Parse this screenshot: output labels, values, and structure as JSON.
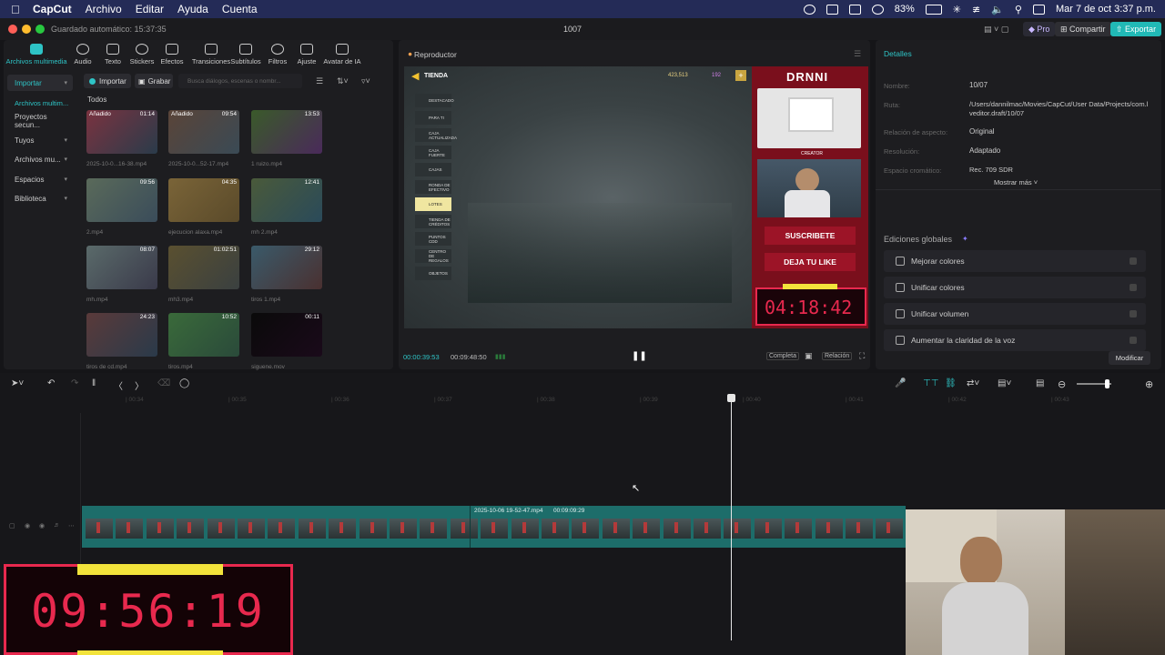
{
  "menubar": {
    "app": "CapCut",
    "items": [
      "Archivo",
      "Editar",
      "Ayuda",
      "Cuenta"
    ],
    "battery": "83%",
    "datetime": "Mar 7 de oct 3:37 p.m."
  },
  "titlebar": {
    "autosave": "Guardado automático: 15:37:35",
    "project": "1007",
    "pro": "Pro",
    "share": "Compartir",
    "export": "Exportar"
  },
  "toolbar": {
    "media": "Archivos multimedia",
    "audio": "Audio",
    "text": "Texto",
    "stickers": "Stickers",
    "effects": "Efectos",
    "transitions": "Transiciones",
    "subtitles": "Subtítulos",
    "filters": "Filtros",
    "adjust": "Ajuste",
    "ai_avatar": "Avatar de IA"
  },
  "media_panel": {
    "sidebar": {
      "import": "Importar",
      "media_files": "Archivos multim...",
      "secure_projects": "Proyectos secun...",
      "yours": "Tuyos",
      "media_more": "Archivos mu...",
      "spaces": "Espacios",
      "library": "Biblioteca"
    },
    "import_button": "Importar",
    "record_button": "Grabar",
    "search_placeholder": "Busca diálogos, escenas o nombr...",
    "filter_all": "Todos",
    "thumbs": [
      {
        "tag": "Añadido",
        "duration": "01:14",
        "name": "2025-10-0...16-38.mp4"
      },
      {
        "tag": "Añadido",
        "duration": "09:54",
        "name": "2025-10-0...52-17.mp4"
      },
      {
        "tag": "",
        "duration": "13:53",
        "name": "1 ruizo.mp4"
      },
      {
        "tag": "",
        "duration": "09:56",
        "name": "2.mp4"
      },
      {
        "tag": "",
        "duration": "04:35",
        "name": "ejecucion alaxa.mp4"
      },
      {
        "tag": "",
        "duration": "12:41",
        "name": "mh 2.mp4"
      },
      {
        "tag": "",
        "duration": "08:07",
        "name": "mh.mp4"
      },
      {
        "tag": "",
        "duration": "01:02:51",
        "name": "mh3.mp4"
      },
      {
        "tag": "",
        "duration": "29:12",
        "name": "tiros 1.mp4"
      },
      {
        "tag": "",
        "duration": "24:23",
        "name": "tiros de cd.mp4"
      },
      {
        "tag": "",
        "duration": "10:52",
        "name": "tiros.mp4"
      },
      {
        "tag": "",
        "duration": "00:11",
        "name": "siguenе.mov"
      }
    ]
  },
  "player": {
    "title": "Reproductor",
    "current_time": "00:00:39:53",
    "total_time": "00:09:48:50",
    "complete_label": "Completa",
    "ratio_label": "Relación",
    "shop_title": "TIENDA",
    "shop_items": [
      "DESTACADO",
      "PARA TI",
      "CAJA ACTUALIZADA",
      "CAJA FUERTE",
      "CAJAS",
      "RONDA DE EFECTIVO",
      "LOTES",
      "TIENDA DE CRÉDITOS",
      "PUNTOS CDD",
      "CENTRO DE REGALOS",
      "OBJETOS"
    ],
    "coins": "423,513",
    "gems": "192",
    "overlay_brand": "DRNNI",
    "overlay_creator": "CREATOR",
    "subscribe": "SUSCRIBETE",
    "like": "DEJA TU LIKE",
    "preview_timer": "04:18:42"
  },
  "details": {
    "title": "Detalles",
    "name_label": "Nombre:",
    "name_value": "10/07",
    "path_label": "Ruta:",
    "path_value": "/Users/dannilmac/Movies/CapCut/User Data/Projects/com.lveditor.draft/10/07",
    "aspect_label": "Relación de aspecto:",
    "aspect_value": "Original",
    "resolution_label": "Resolución:",
    "resolution_value": "Adaptado",
    "color_label": "Espacio cromático:",
    "color_value": "Rec. 709 SDR",
    "show_more": "Mostrar más",
    "global_edits": "Ediciones globales",
    "improve_colors": "Mejorar colores",
    "unify_colors": "Unificar colores",
    "unify_volume": "Unificar volumen",
    "voice_clarity": "Aumentar la claridad de la voz",
    "modify": "Modificar"
  },
  "timeline": {
    "ticks": [
      "00:34",
      "00:35",
      "00:36",
      "00:37",
      "00:38",
      "00:39",
      "00:40",
      "00:41",
      "00:42",
      "00:43"
    ],
    "clip_label": "2025-10-06 19-52-47.mp4",
    "clip_duration": "00:09:09:29",
    "big_timer": "09:56:19"
  },
  "colors": {
    "accent": "#2ec4c6",
    "export_bg": "#21b9b6",
    "timer_red": "#e8294e",
    "timer_yellow": "#f2e33b",
    "clip_teal": "#1d6d6a"
  }
}
